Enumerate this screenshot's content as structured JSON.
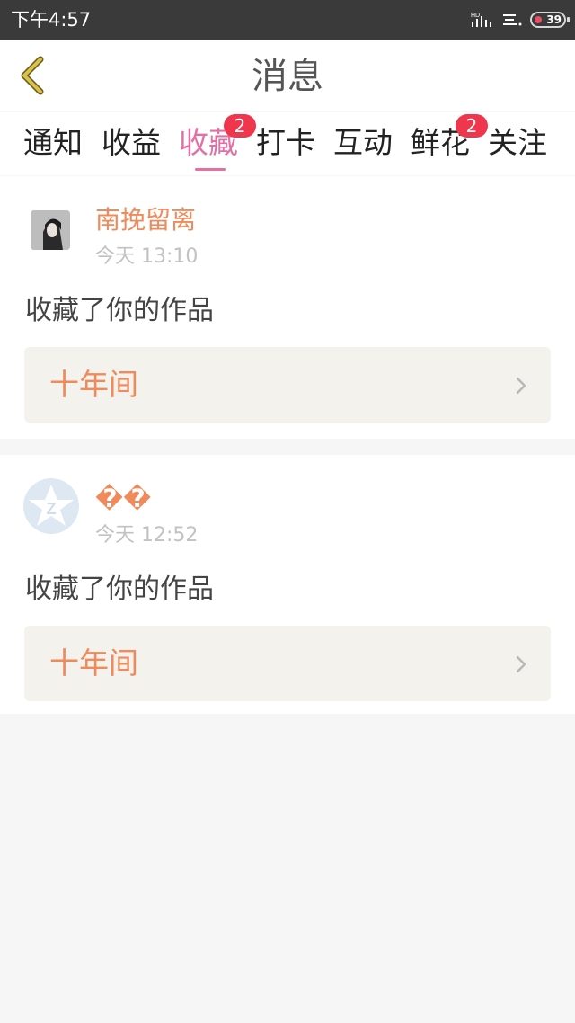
{
  "status_bar": {
    "time": "下午4:57",
    "battery_level": "39"
  },
  "header": {
    "title": "消息"
  },
  "tabs": [
    {
      "label": "通知",
      "active": false,
      "badge": ""
    },
    {
      "label": "收益",
      "active": false,
      "badge": ""
    },
    {
      "label": "收藏",
      "active": true,
      "badge": "2"
    },
    {
      "label": "打卡",
      "active": false,
      "badge": ""
    },
    {
      "label": "互动",
      "active": false,
      "badge": ""
    },
    {
      "label": "鲜花",
      "active": false,
      "badge": "2"
    },
    {
      "label": "关注",
      "active": false,
      "badge": ""
    }
  ],
  "messages": [
    {
      "user_name": "南挽留离",
      "time": "今天 13:10",
      "action": "收藏了你的作品",
      "work_title": "十年间"
    },
    {
      "user_name": "��",
      "time": "今天 12:52",
      "action": "收藏了你的作品",
      "work_title": "十年间"
    }
  ],
  "colors": {
    "accent_pink": "#e46fa4",
    "accent_orange": "#f08a5a",
    "badge_red": "#f0364c",
    "back_arrow": "#d9c24a"
  }
}
